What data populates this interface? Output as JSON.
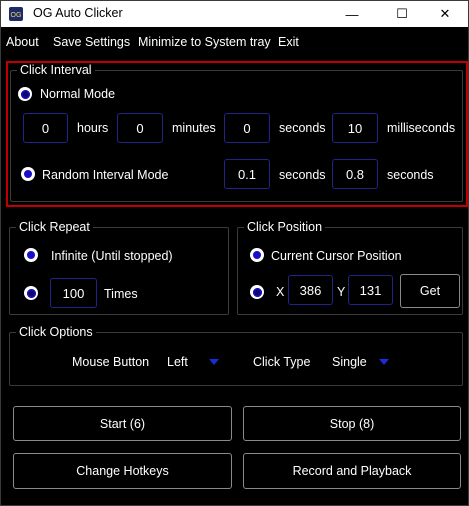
{
  "window": {
    "title": "OG Auto Clicker",
    "minimize": "—",
    "maximize": "☐",
    "close": "✕"
  },
  "menu": [
    "About",
    "Save Settings",
    "Minimize to System tray",
    "Exit"
  ],
  "click_interval": {
    "legend": "Click Interval",
    "normal_mode_label": "Normal Mode",
    "hours_value": "0",
    "hours_label": "hours",
    "minutes_value": "0",
    "minutes_label": "minutes",
    "seconds_value": "0",
    "seconds_label": "seconds",
    "ms_value": "10",
    "ms_label": "milliseconds",
    "random_mode_label": "Random Interval Mode",
    "random_min_value": "0.1",
    "random_min_label": "seconds",
    "random_max_value": "0.8",
    "random_max_label": "seconds"
  },
  "click_repeat": {
    "legend": "Click Repeat",
    "infinite_label": "Infinite (Until stopped)",
    "times_value": "100",
    "times_label": "Times"
  },
  "click_position": {
    "legend": "Click Position",
    "current_label": "Current Cursor Position",
    "x_label": "X",
    "x_value": "386",
    "y_label": "Y",
    "y_value": "131",
    "get_label": "Get"
  },
  "click_options": {
    "legend": "Click Options",
    "mouse_button_label": "Mouse Button",
    "mouse_button_value": "Left",
    "click_type_label": "Click Type",
    "click_type_value": "Single"
  },
  "buttons": {
    "start": "Start (6)",
    "stop": "Stop (8)",
    "hotkeys": "Change Hotkeys",
    "record": "Record and Playback"
  },
  "colors": {
    "background": "#000000",
    "accent": "#1a2cd6",
    "highlight_border": "#c00000"
  }
}
